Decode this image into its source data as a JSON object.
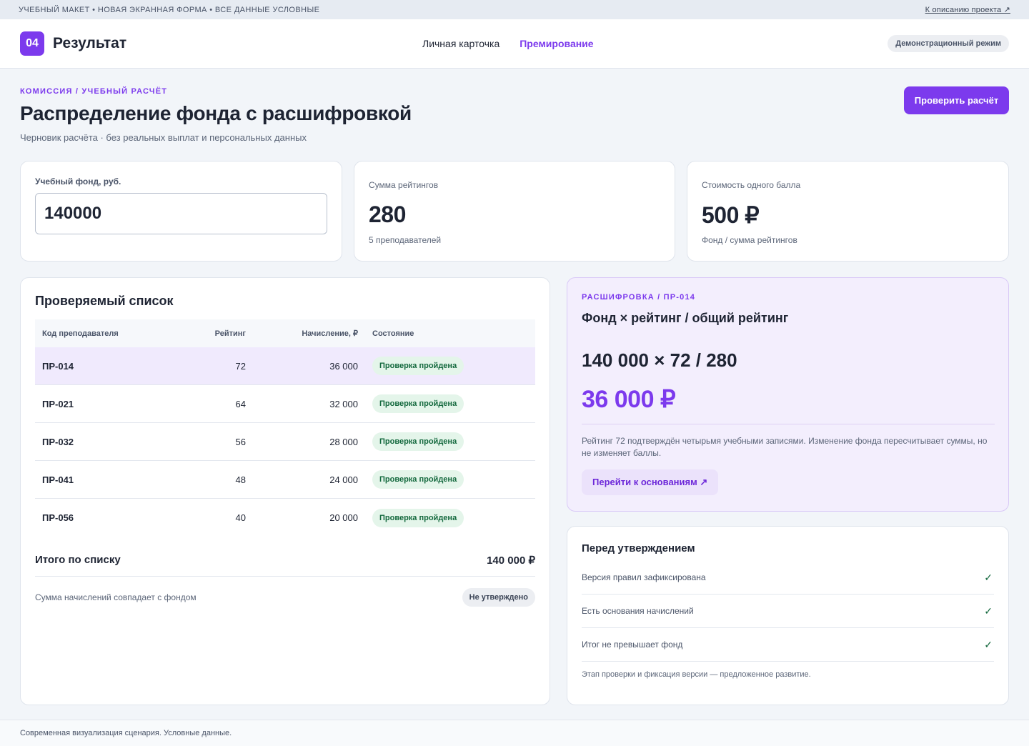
{
  "topstrip": {
    "notice": "УЧЕБНЫЙ МАКЕТ • НОВАЯ ЭКРАННАЯ ФОРМА • ВСЕ ДАННЫЕ УСЛОВНЫЕ",
    "link": "К описанию проекта ↗"
  },
  "header": {
    "badge": "04",
    "title": "Результат",
    "nav": [
      {
        "label": "Личная карточка",
        "active": false
      },
      {
        "label": "Премирование",
        "active": true
      }
    ],
    "mode": "Демонстрационный режим"
  },
  "page": {
    "eyebrow": "КОМИССИЯ / УЧЕБНЫЙ РАСЧЁТ",
    "title": "Распределение фонда с расшифровкой",
    "subtitle": "Черновик расчёта · без реальных выплат и персональных данных",
    "check_button": "Проверить расчёт"
  },
  "stats": {
    "fund_label": "Учебный фонд, руб.",
    "fund_value": "140000",
    "ratings_label": "Сумма рейтингов",
    "ratings_value": "280",
    "ratings_note": "5 преподавателей",
    "point_label": "Стоимость одного балла",
    "point_value": "500 ₽",
    "point_note": "Фонд / сумма рейтингов"
  },
  "list": {
    "title": "Проверяемый список",
    "columns": [
      "Код преподавателя",
      "Рейтинг",
      "Начисление, ₽",
      "Состояние"
    ],
    "rows": [
      {
        "code": "ПР-014",
        "rating": "72",
        "amount": "36 000",
        "status": "Проверка пройдена"
      },
      {
        "code": "ПР-021",
        "rating": "64",
        "amount": "32 000",
        "status": "Проверка пройдена"
      },
      {
        "code": "ПР-032",
        "rating": "56",
        "amount": "28 000",
        "status": "Проверка пройдена"
      },
      {
        "code": "ПР-041",
        "rating": "48",
        "amount": "24 000",
        "status": "Проверка пройдена"
      },
      {
        "code": "ПР-056",
        "rating": "40",
        "amount": "20 000",
        "status": "Проверка пройдена"
      }
    ],
    "total_label": "Итого по списку",
    "total_value": "140 000 ₽",
    "match_text": "Сумма начислений совпадает с фондом",
    "match_badge": "Не утверждено"
  },
  "breakdown": {
    "eyebrow": "РАСШИФРОВКА / ПР-014",
    "formula_title": "Фонд × рейтинг / общий рейтинг",
    "expression": "140 000 × 72 / 280",
    "result": "36 000 ₽",
    "text": "Рейтинг 72 подтверждён четырьмя учебными записями. Изменение фонда пересчитывает суммы, но не изменяет баллы.",
    "link": "Перейти к основаниям ↗"
  },
  "approval": {
    "title": "Перед утверждением",
    "items": [
      {
        "label": "Версия правил зафиксирована",
        "check": "✓"
      },
      {
        "label": "Есть основания начислений",
        "check": "✓"
      },
      {
        "label": "Итог не превышает фонд",
        "check": "✓"
      }
    ],
    "note": "Этап проверки и фиксация версии — предложенное развитие."
  },
  "footer": {
    "text": "Современная визуализация сценария. Условные данные."
  },
  "colors": {
    "accent": "#7c3aed",
    "success_bg": "#e4f5ea",
    "success_text": "#14693e"
  }
}
